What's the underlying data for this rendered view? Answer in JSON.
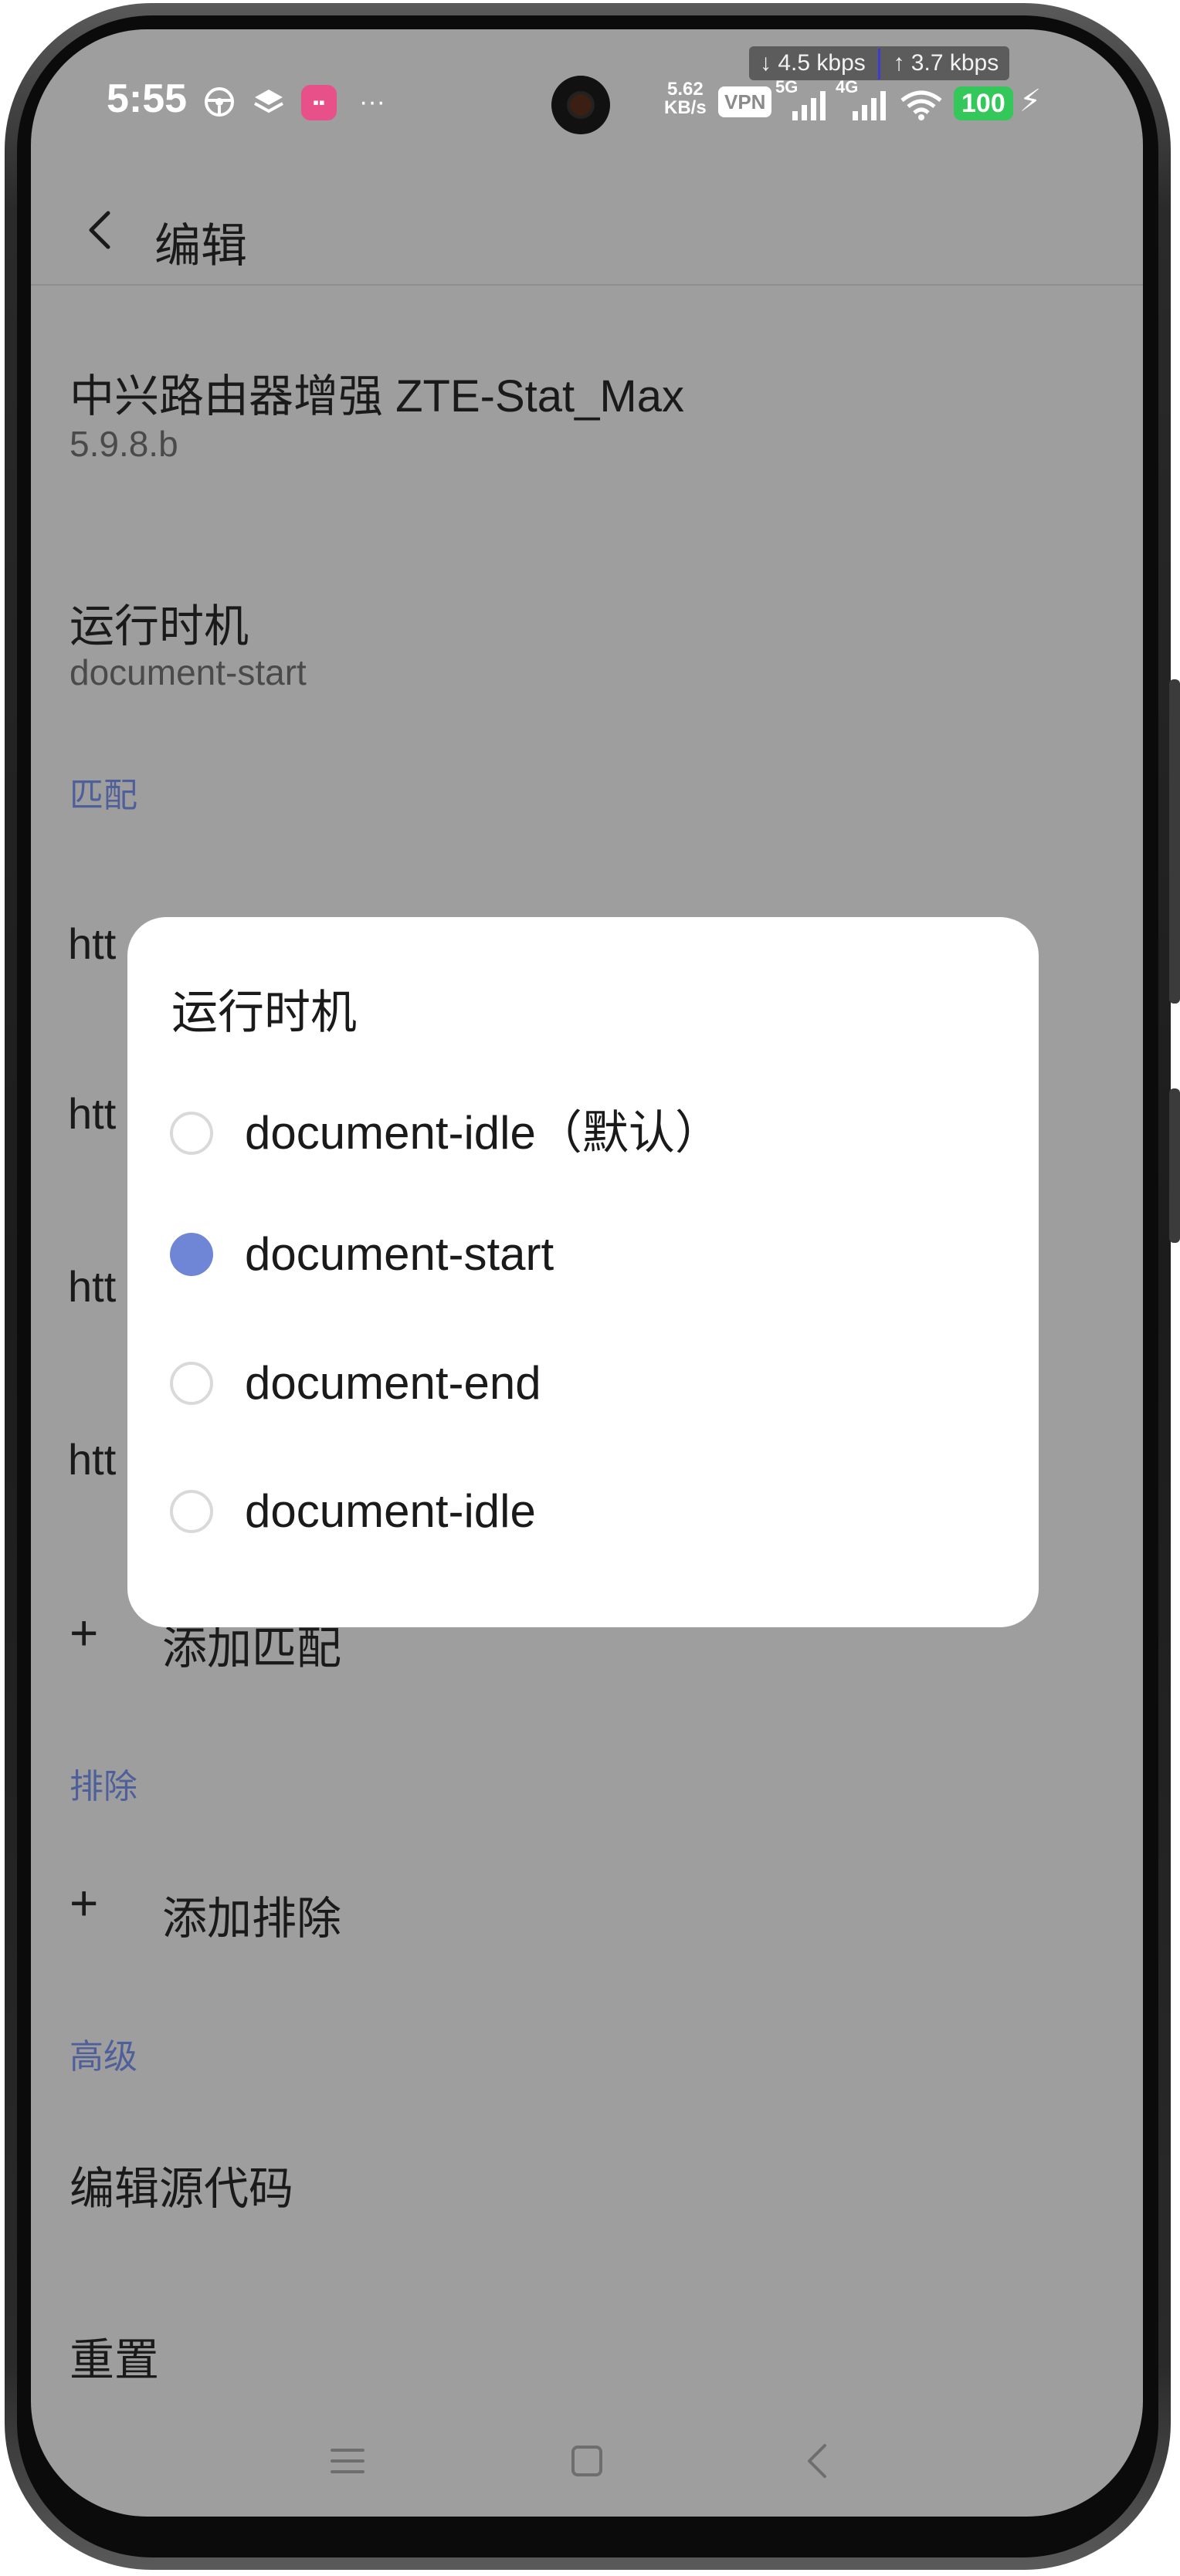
{
  "status_bar": {
    "time": "5:55",
    "net_speed_value": "5.62",
    "net_speed_unit": "KB/s",
    "vpn": "VPN",
    "sim1_label": "5G",
    "sim2_label": "4G",
    "battery": "100",
    "download_arrow": "↓",
    "download_speed": "4.5 kbps",
    "upload_arrow": "↑",
    "upload_speed": "3.7 kbps",
    "more": "···"
  },
  "header": {
    "title": "编辑"
  },
  "script": {
    "name": "中兴路由器增强 ZTE-Stat_Max",
    "version": "5.9.8.b"
  },
  "run_at": {
    "label": "运行时机",
    "value": "document-start"
  },
  "match_section": {
    "header": "匹配",
    "items": [
      "htt",
      "htt",
      "htt",
      "htt"
    ],
    "add_label": "添加匹配",
    "add_icon": "+"
  },
  "exclude_section": {
    "header": "排除",
    "add_label": "添加排除",
    "add_icon": "+"
  },
  "advanced_section": {
    "header": "高级",
    "edit_source": "编辑源代码",
    "reset": "重置"
  },
  "dialog": {
    "title": "运行时机",
    "options": [
      {
        "label": "document-idle（默认）",
        "selected": false
      },
      {
        "label": "document-start",
        "selected": true
      },
      {
        "label": "document-end",
        "selected": false
      },
      {
        "label": "document-idle",
        "selected": false
      }
    ],
    "accent_color": "#6f86d6"
  },
  "colors": {
    "scrim_background": "#9e9e9e",
    "section_header": "#4f5f9a",
    "battery": "#34c759"
  }
}
